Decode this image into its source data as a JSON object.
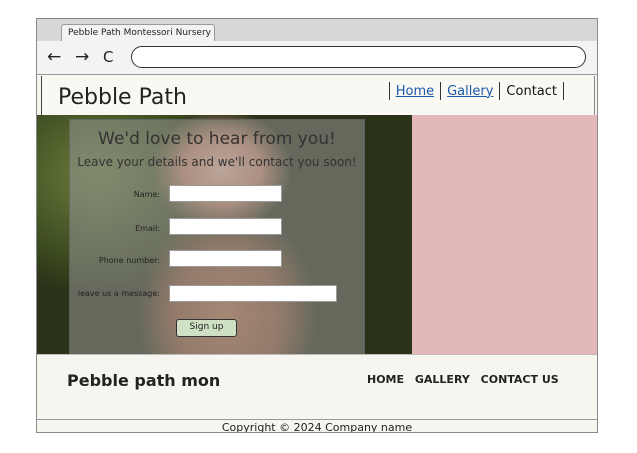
{
  "browser": {
    "tab_title": "Pebble Path Montessori Nursery",
    "back_symbol": "←",
    "forward_symbol": "→",
    "reload_symbol": "C",
    "address_value": ""
  },
  "header": {
    "brand": "Pebble Path",
    "nav": {
      "home": "Home",
      "gallery": "Gallery",
      "contact": "Contact"
    }
  },
  "form": {
    "title": "We'd love to hear from you!",
    "subtitle": "Leave your details and we'll contact you soon!",
    "name_label": "Name:",
    "email_label": "Email:",
    "phone_label": "Phone number:",
    "message_label": "leave us a message:",
    "submit_label": "Sign up"
  },
  "footer": {
    "brand": "Pebble path mon",
    "nav": {
      "home": "HOME",
      "gallery": "GALLERY",
      "contact": "CONTACT US"
    },
    "copyright": "Copyright © 2024 Company name"
  },
  "colors": {
    "side_panel": "#e2b8b8",
    "link": "#1a5aa8",
    "button": "#cfe0c4"
  }
}
